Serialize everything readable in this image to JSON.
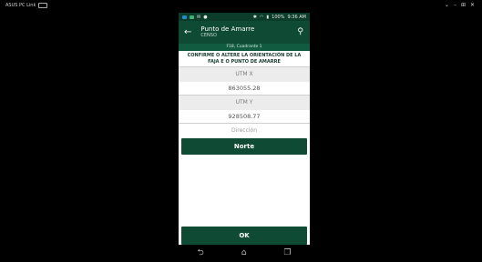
{
  "desktop": {
    "title": "ASUS PC Link",
    "controls": [
      "⌄",
      "–",
      "⊞",
      "✕"
    ]
  },
  "status_bar": {
    "battery": "100%",
    "time": "9:36 AM"
  },
  "app_bar": {
    "back_icon": "arrow-left",
    "title": "Punto de Amarre",
    "subtitle": "CENSO",
    "action_icon": "map-pin"
  },
  "breadcrumb": "F18, Cuadrante 1",
  "instruction": "CONFIRME O ALTERE LA ORIENTACIÓN DE LA FAJA E O PUNTO DE AMARRE",
  "fields": {
    "utm_x": {
      "label": "UTM X",
      "value": "863055.28"
    },
    "utm_y": {
      "label": "UTM Y",
      "value": "928508.77"
    }
  },
  "direction": {
    "label": "Dirección",
    "value": "Norte"
  },
  "ok_button": "OK",
  "nav": [
    "back",
    "home",
    "recents"
  ]
}
